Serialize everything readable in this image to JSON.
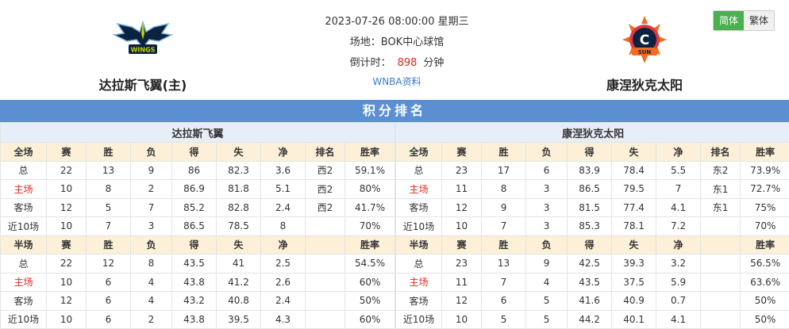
{
  "header": {
    "home_team": "达拉斯飞翼(主)",
    "away_team": "康涅狄克太阳",
    "date": "2023-07-26 08:00:00 星期三",
    "venue": "场地：BOK中心球馆",
    "countdown_label": "倒计时：",
    "countdown_value": "898",
    "countdown_unit": "分钟",
    "link": "WNBA资料",
    "home_logo_text": "WINGS",
    "away_logo_letter": "C",
    "away_logo_text": "SUN"
  },
  "lang": {
    "simplified": "简体",
    "traditional": "繁体"
  },
  "section_title": "积分排名",
  "home_table": {
    "caption": "达拉斯飞翼",
    "full_head": [
      "全场",
      "赛",
      "胜",
      "负",
      "得",
      "失",
      "净",
      "排名",
      "胜率"
    ],
    "full_rows": [
      [
        "总",
        "22",
        "13",
        "9",
        "86",
        "82.3",
        "3.6",
        "西2",
        "59.1%"
      ],
      [
        "主场",
        "10",
        "8",
        "2",
        "86.9",
        "81.8",
        "5.1",
        "西2",
        "80%"
      ],
      [
        "客场",
        "12",
        "5",
        "7",
        "85.2",
        "82.8",
        "2.4",
        "西2",
        "41.7%"
      ],
      [
        "近10场",
        "10",
        "7",
        "3",
        "86.5",
        "78.5",
        "8",
        "",
        "70%"
      ]
    ],
    "half_head": [
      "半场",
      "赛",
      "胜",
      "负",
      "得",
      "失",
      "净",
      "",
      "胜率"
    ],
    "half_rows": [
      [
        "总",
        "22",
        "12",
        "8",
        "43.5",
        "41",
        "2.5",
        "",
        "54.5%"
      ],
      [
        "主场",
        "10",
        "6",
        "4",
        "43.8",
        "41.2",
        "2.6",
        "",
        "60%"
      ],
      [
        "客场",
        "12",
        "6",
        "4",
        "43.2",
        "40.8",
        "2.4",
        "",
        "50%"
      ],
      [
        "近10场",
        "10",
        "6",
        "2",
        "43.8",
        "39.5",
        "4.3",
        "",
        "60%"
      ]
    ]
  },
  "away_table": {
    "caption": "康涅狄克太阳",
    "full_head": [
      "全场",
      "赛",
      "胜",
      "负",
      "得",
      "失",
      "净",
      "排名",
      "胜率"
    ],
    "full_rows": [
      [
        "总",
        "23",
        "17",
        "6",
        "83.9",
        "78.4",
        "5.5",
        "东2",
        "73.9%"
      ],
      [
        "主场",
        "11",
        "8",
        "3",
        "86.5",
        "79.5",
        "7",
        "东1",
        "72.7%"
      ],
      [
        "客场",
        "12",
        "9",
        "3",
        "81.5",
        "77.4",
        "4.1",
        "东1",
        "75%"
      ],
      [
        "近10场",
        "10",
        "7",
        "3",
        "85.3",
        "78.1",
        "7.2",
        "",
        "70%"
      ]
    ],
    "half_head": [
      "半场",
      "赛",
      "胜",
      "负",
      "得",
      "失",
      "净",
      "",
      "胜率"
    ],
    "half_rows": [
      [
        "总",
        "23",
        "13",
        "9",
        "42.5",
        "39.3",
        "3.2",
        "",
        "56.5%"
      ],
      [
        "主场",
        "11",
        "7",
        "4",
        "43.5",
        "37.5",
        "5.9",
        "",
        "63.6%"
      ],
      [
        "客场",
        "12",
        "6",
        "5",
        "41.6",
        "40.9",
        "0.7",
        "",
        "50%"
      ],
      [
        "近10场",
        "10",
        "5",
        "5",
        "44.2",
        "40.1",
        "4.1",
        "",
        "50%"
      ]
    ]
  },
  "colors": {
    "accent": "#5b8fd1",
    "red": "#e0271f",
    "green": "#4caf50",
    "head_bg": "#fcf1d8"
  }
}
